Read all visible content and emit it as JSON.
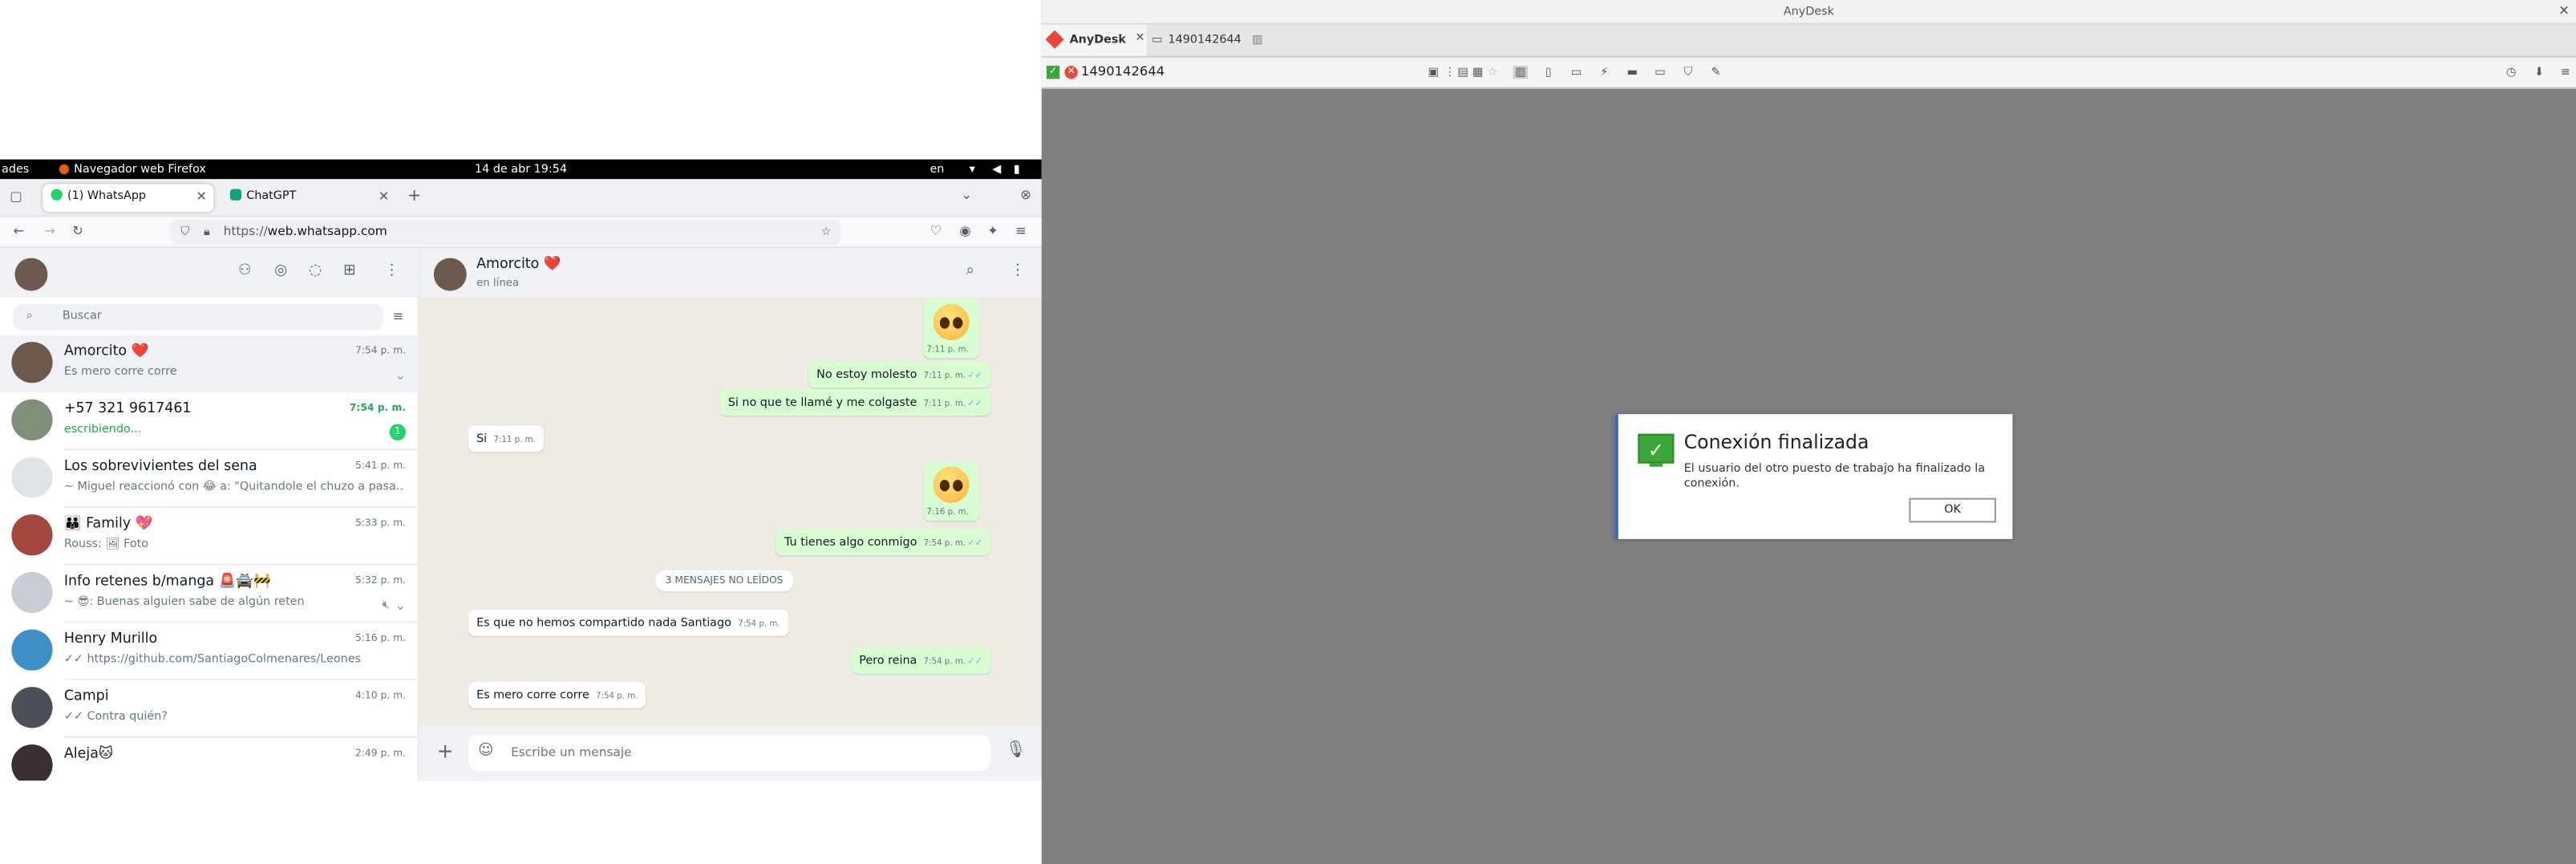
{
  "gnome_bar": {
    "activities": "ades",
    "app": "Navegador web Firefox",
    "clock": "14 de abr 19:54",
    "lang": "en"
  },
  "firefox": {
    "tabs": [
      {
        "label": "(1) WhatsApp",
        "fav_color": "#25d366"
      },
      {
        "label": "ChatGPT",
        "fav_color": "#10a37f"
      }
    ],
    "url_domain": "web.whatsapp.com",
    "url_prefix": "https://"
  },
  "whatsapp": {
    "search_placeholder": "Buscar",
    "chats": [
      {
        "name": "Amorcito ❤️",
        "msg": "Es mero corre corre",
        "time": "7:54 p. m.",
        "avatar_color": "#6d5a4c"
      },
      {
        "name": "+57 321 9617461",
        "msg": "escribiendo...",
        "time": "7:54 p. m.",
        "badge": "1",
        "avatar_color": "#7f8f7a"
      },
      {
        "name": "Los sobrevivientes del sena",
        "msg": "~ Miguel reaccionó con 😂 a: \"Quitandole el chuzo a pasa...",
        "time": "5:41 p. m.",
        "avatar_color": "#dfe5e7"
      },
      {
        "name": "👪 Family 💖",
        "msg": "Rouss: 🖼 Foto",
        "time": "5:33 p. m.",
        "avatar_color": "#a4483f"
      },
      {
        "name": "Info retenes b/manga 🚨🚔🚧",
        "msg": "~ 😎: Buenas alguien sabe de algún reten",
        "time": "5:32 p. m.",
        "avatar_color": "#c8cdd4"
      },
      {
        "name": "Henry Murillo",
        "msg": "✓✓ https://github.com/SantiagoColmenares/Leones",
        "time": "5:16 p. m.",
        "avatar_color": "#3f8fc7"
      },
      {
        "name": "Campi",
        "msg": "✓✓ Contra quién?",
        "time": "4:10 p. m.",
        "avatar_color": "#4a4f58"
      },
      {
        "name": "Aleja🐱",
        "msg": "",
        "time": "2:49 p. m.",
        "avatar_color": "#3a2f33"
      }
    ],
    "active_chat": {
      "name": "Amorcito ❤️",
      "status": "en línea"
    },
    "messages": [
      {
        "text": "No estoy molesto",
        "time": "7:11 p. m."
      },
      {
        "text": "Si no que te llamé y me colgaste",
        "time": "7:11 p. m."
      },
      {
        "text": "Si",
        "time": "7:11 p. m."
      },
      {
        "text": "Tu tienes algo conmigo",
        "time": "7:54 p. m."
      },
      {
        "text": "Es que no hemos compartido nada Santiago",
        "time": "7:54 p. m."
      },
      {
        "text": "Pero reina",
        "time": "7:54 p. m."
      },
      {
        "text": "Es mero corre corre",
        "time": "7:54 p. m."
      }
    ],
    "emoji_times": [
      "7:11 p. m.",
      "7:16 p. m."
    ],
    "unread_label": "3 MENSAJES NO LEÍDOS",
    "composer_placeholder": "Escribe un mensaje"
  },
  "anydesk": {
    "window_title": "AnyDesk",
    "brand": "AnyDesk",
    "session_tab": "1490142644",
    "address": "1490142644",
    "dialog": {
      "title": "Conexión finalizada",
      "body": "El usuario del otro puesto de trabajo ha finalizado la conexión.",
      "ok_label": "OK"
    }
  },
  "colors": {
    "wa_green": "#25d366",
    "anydesk_red": "#ef443b",
    "anydesk_bg": "#808080"
  }
}
